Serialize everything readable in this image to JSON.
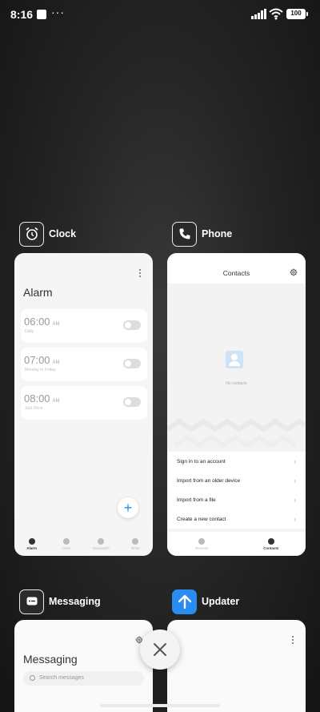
{
  "status_bar": {
    "time": "8:16",
    "dots": "···",
    "battery": "100"
  },
  "apps": {
    "clock": {
      "name": "Clock",
      "icon": "alarm-clock-icon"
    },
    "phone": {
      "name": "Phone",
      "icon": "phone-icon"
    },
    "messaging": {
      "name": "Messaging",
      "icon": "message-icon"
    },
    "updater": {
      "name": "Updater",
      "icon": "up-arrow-icon",
      "icon_color": "#2a8cf0"
    }
  },
  "clock_card": {
    "title": "Alarm",
    "alarms": [
      {
        "time": "06:00",
        "ampm": "AM",
        "sub": "Daily"
      },
      {
        "time": "07:00",
        "ampm": "AM",
        "sub": "Monday to Friday"
      },
      {
        "time": "08:00",
        "ampm": "AM",
        "sub": "Just Once"
      }
    ],
    "nav": [
      "Alarm",
      "Clock",
      "Stopwatch",
      "Timer"
    ]
  },
  "phone_card": {
    "title": "Contacts",
    "empty_text": "No contacts",
    "menu": [
      "Sign in to an account",
      "Import from an older device",
      "Import from a file",
      "Create a new contact"
    ],
    "nav": [
      "Recents",
      "Contacts"
    ]
  },
  "messaging_card": {
    "title": "Messaging",
    "search_placeholder": "Search messages"
  },
  "colors": {
    "accent": "#2a8cf0"
  }
}
